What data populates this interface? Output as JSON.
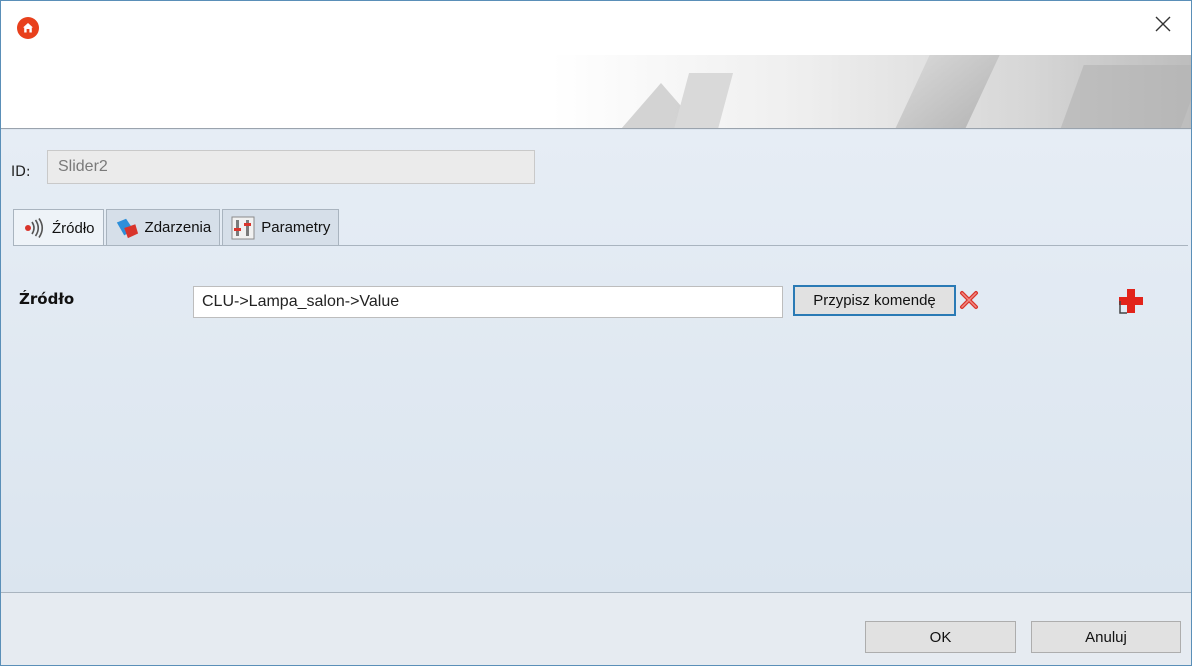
{
  "window": {
    "icons": {
      "app": "home-icon",
      "close": "close-icon"
    },
    "colors": {
      "accent": "#e8401c",
      "focus": "#2a7ab5"
    }
  },
  "id_row": {
    "label": "ID:",
    "value": "Slider2"
  },
  "tabs": [
    {
      "label": "Źródło",
      "icon": "source-signal-icon",
      "active": true
    },
    {
      "label": "Zdarzenia",
      "icon": "events-icon",
      "active": false
    },
    {
      "label": "Parametry",
      "icon": "parameters-icon",
      "active": false
    }
  ],
  "source": {
    "label": "Źródło",
    "value": "CLU->Lampa_salon->Value",
    "assign_button": "Przypisz komendę",
    "clear_icon": "clear-x-icon",
    "add_icon": "add-plus-icon"
  },
  "footer": {
    "ok": "OK",
    "cancel": "Anuluj"
  }
}
